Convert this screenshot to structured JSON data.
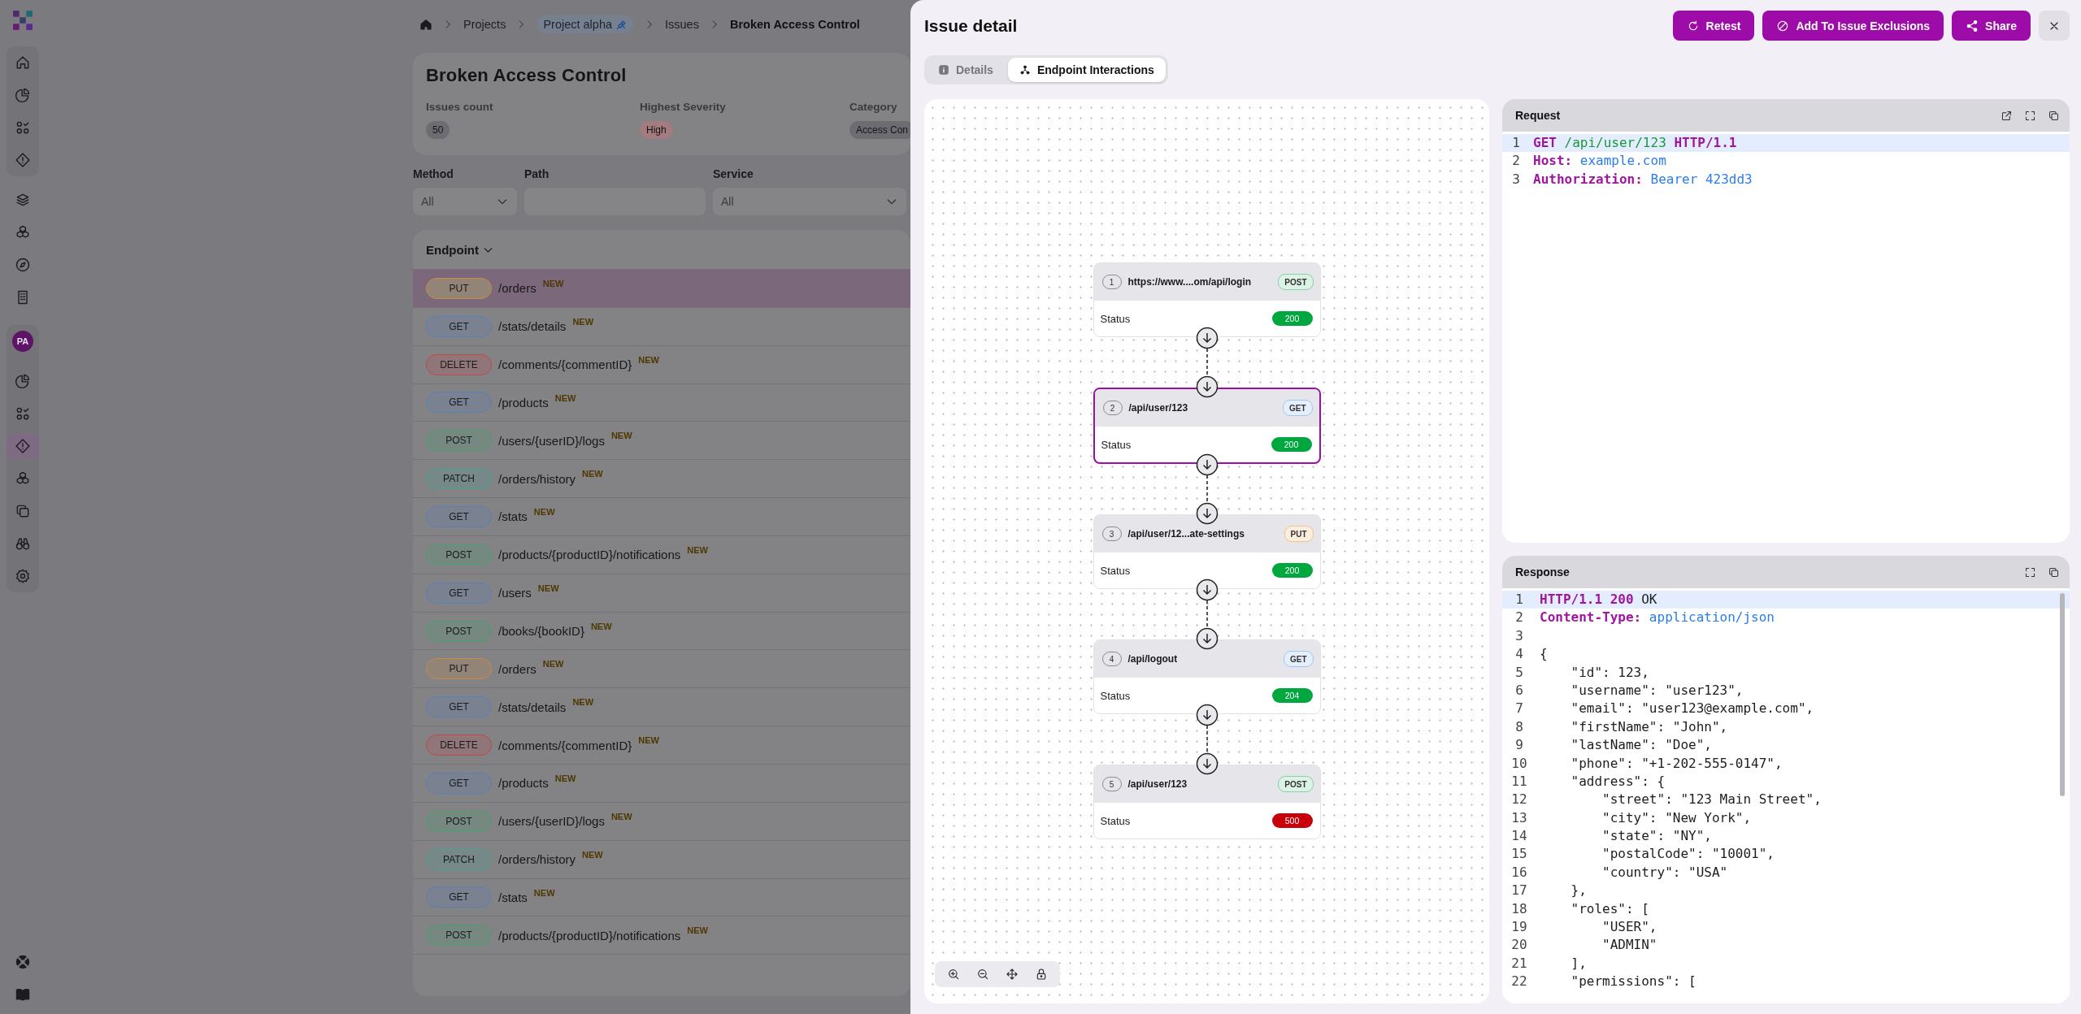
{
  "sidebar": {
    "top_items": [
      {
        "selected": false
      },
      {
        "selected": false
      },
      {
        "selected": false
      },
      {
        "selected": false
      }
    ],
    "nav_items": [
      {
        "selected": false
      },
      {
        "selected": false
      },
      {
        "selected": false
      },
      {
        "selected": false
      }
    ],
    "project": {
      "avatar": "PA",
      "items": [
        {
          "selected": false
        },
        {
          "selected": false
        },
        {
          "selected": true
        },
        {
          "selected": false
        },
        {
          "selected": false
        },
        {
          "selected": false
        },
        {
          "selected": false
        }
      ]
    },
    "bottom_items": [
      {
        "selected": false
      },
      {
        "selected": false
      }
    ]
  },
  "breadcrumb": [
    {
      "label": "Projects",
      "kind": "link"
    },
    {
      "label": "Project alpha",
      "kind": "project"
    },
    {
      "label": "Issues",
      "kind": "link"
    },
    {
      "label": "Broken Access Control",
      "kind": "current"
    }
  ],
  "summary": {
    "title": "Broken Access Control",
    "fields": [
      {
        "label": "Issues count",
        "value": "50",
        "color": "#6c6c72"
      },
      {
        "label": "Highest Severity",
        "value": "High",
        "color": "#a27c7e"
      },
      {
        "label": "Category",
        "value": "Access Con",
        "color": "#6c6c72"
      }
    ]
  },
  "filters": [
    {
      "label": "Method",
      "value": "All",
      "kind": "select"
    },
    {
      "label": "Path",
      "kind": "text"
    },
    {
      "label": "Service",
      "value": "All",
      "kind": "select"
    }
  ],
  "table": {
    "columns": [
      "Endpoint"
    ],
    "rows": [
      {
        "method": "PUT",
        "color": "#c98a45",
        "path": "/orders",
        "badge": "NEW",
        "selected": true
      },
      {
        "method": "GET",
        "color": "#5a80b8",
        "path": "/stats/details",
        "badge": "NEW",
        "selected": false
      },
      {
        "method": "DELETE",
        "color": "#c04848",
        "path": "/comments/{commentID}",
        "badge": "NEW",
        "selected": false
      },
      {
        "method": "GET",
        "color": "#5a80b8",
        "path": "/products",
        "badge": "NEW",
        "selected": false
      },
      {
        "method": "POST",
        "color": "#48a070",
        "path": "/users/{userID}/logs",
        "badge": "NEW",
        "selected": false
      },
      {
        "method": "PATCH",
        "color": "#48a090",
        "path": "/orders/history",
        "badge": "NEW",
        "selected": false
      },
      {
        "method": "GET",
        "color": "#5a80b8",
        "path": "/stats",
        "badge": "NEW",
        "selected": false
      },
      {
        "method": "POST",
        "color": "#48a070",
        "path": "/products/{productID}/notifications",
        "badge": "NEW",
        "selected": false
      },
      {
        "method": "GET",
        "color": "#5a80b8",
        "path": "/users",
        "badge": "NEW",
        "selected": false
      },
      {
        "method": "POST",
        "color": "#48a070",
        "path": "/books/{bookID}",
        "badge": "NEW",
        "selected": false
      },
      {
        "method": "PUT",
        "color": "#c98a45",
        "path": "/orders",
        "badge": "NEW",
        "selected": false
      },
      {
        "method": "GET",
        "color": "#5a80b8",
        "path": "/stats/details",
        "badge": "NEW",
        "selected": false
      },
      {
        "method": "DELETE",
        "color": "#c04848",
        "path": "/comments/{commentID}",
        "badge": "NEW",
        "selected": false
      },
      {
        "method": "GET",
        "color": "#5a80b8",
        "path": "/products",
        "badge": "NEW",
        "selected": false
      },
      {
        "method": "POST",
        "color": "#48a070",
        "path": "/users/{userID}/logs",
        "badge": "NEW",
        "selected": false
      },
      {
        "method": "PATCH",
        "color": "#48a090",
        "path": "/orders/history",
        "badge": "NEW",
        "selected": false
      },
      {
        "method": "GET",
        "color": "#5a80b8",
        "path": "/stats",
        "badge": "NEW",
        "selected": false
      },
      {
        "method": "POST",
        "color": "#48a070",
        "path": "/products/{productID}/notifications",
        "badge": "NEW",
        "selected": false
      }
    ]
  },
  "issue_detail": {
    "title": "Issue detail",
    "actions": [
      {
        "label": "Retest",
        "kind": "retest"
      },
      {
        "label": "Add To Issue Exclusions",
        "kind": "exclude"
      },
      {
        "label": "Share",
        "kind": "share"
      }
    ],
    "tabs": [
      {
        "label": "Details",
        "kind": "info",
        "selected": false
      },
      {
        "label": "Endpoint Interactions",
        "kind": "flow",
        "selected": true
      }
    ],
    "flow": {
      "nodes": [
        {
          "number": "1",
          "url": "https://www....om/api/login",
          "method": {
            "label": "POST",
            "color": "#86d1a5"
          },
          "status_label": "Status",
          "status": {
            "label": "200",
            "color": "#00a63e"
          },
          "selected": false
        },
        {
          "number": "2",
          "url": "/api/user/123",
          "method": {
            "label": "GET",
            "color": "#9fc6f2"
          },
          "status_label": "Status",
          "status": {
            "label": "200",
            "color": "#00a63e"
          },
          "selected": true
        },
        {
          "number": "3",
          "url": "/api/user/12...ate-settings",
          "method": {
            "label": "PUT",
            "color": "#f2c28c"
          },
          "status_label": "Status",
          "status": {
            "label": "200",
            "color": "#00a63e"
          },
          "selected": false
        },
        {
          "number": "4",
          "url": "/api/logout",
          "method": {
            "label": "GET",
            "color": "#9fc6f2"
          },
          "status_label": "Status",
          "status": {
            "label": "204",
            "color": "#00a63e"
          },
          "selected": false
        },
        {
          "number": "5",
          "url": "/api/user/123",
          "method": {
            "label": "POST",
            "color": "#86d1a5"
          },
          "status_label": "Status",
          "status": {
            "label": "500",
            "color": "#c8000a"
          },
          "selected": false
        }
      ]
    },
    "request": {
      "title": "Request",
      "lines": [
        {
          "number": "1",
          "highlighted": true,
          "tokens": [
            {
              "kind": "keyword",
              "text": "GET"
            },
            {
              "kind": "path",
              "text": " /api/user/123 "
            },
            {
              "kind": "keyword",
              "text": "HTTP/1.1"
            }
          ]
        },
        {
          "number": "2",
          "highlighted": false,
          "tokens": [
            {
              "kind": "keyword",
              "text": "Host:"
            },
            {
              "kind": "value",
              "text": " example.com"
            }
          ]
        },
        {
          "number": "3",
          "highlighted": false,
          "tokens": [
            {
              "kind": "keyword",
              "text": "Authorization:"
            },
            {
              "kind": "value",
              "text": " Bearer 423dd3"
            }
          ]
        }
      ]
    },
    "response": {
      "title": "Response",
      "lines": [
        {
          "number": "1",
          "highlighted": true,
          "tokens": [
            {
              "kind": "keyword",
              "text": "HTTP/1.1 200"
            },
            {
              "kind": "plain",
              "text": " OK"
            }
          ]
        },
        {
          "number": "2",
          "highlighted": false,
          "tokens": [
            {
              "kind": "keyword",
              "text": "Content-Type:"
            },
            {
              "kind": "value",
              "text": " application/json"
            }
          ]
        },
        {
          "number": "3",
          "highlighted": false
        },
        {
          "number": "4",
          "highlighted": false,
          "tokens": [
            {
              "kind": "plain",
              "text": "{"
            }
          ]
        },
        {
          "number": "5",
          "highlighted": false,
          "tokens": [
            {
              "kind": "plain",
              "text": "    \"id\": 123,"
            }
          ]
        },
        {
          "number": "6",
          "highlighted": false,
          "tokens": [
            {
              "kind": "plain",
              "text": "    \"username\": \"user123\","
            }
          ]
        },
        {
          "number": "7",
          "highlighted": false,
          "tokens": [
            {
              "kind": "plain",
              "text": "    \"email\": \"user123@example.com\","
            }
          ]
        },
        {
          "number": "8",
          "highlighted": false,
          "tokens": [
            {
              "kind": "plain",
              "text": "    \"firstName\": \"John\","
            }
          ]
        },
        {
          "number": "9",
          "highlighted": false,
          "tokens": [
            {
              "kind": "plain",
              "text": "    \"lastName\": \"Doe\","
            }
          ]
        },
        {
          "number": "10",
          "highlighted": false,
          "tokens": [
            {
              "kind": "plain",
              "text": "    \"phone\": \"+1-202-555-0147\","
            }
          ]
        },
        {
          "number": "11",
          "highlighted": false,
          "tokens": [
            {
              "kind": "plain",
              "text": "    \"address\": {"
            }
          ]
        },
        {
          "number": "12",
          "highlighted": false,
          "tokens": [
            {
              "kind": "plain",
              "text": "        \"street\": \"123 Main Street\","
            }
          ]
        },
        {
          "number": "13",
          "highlighted": false,
          "tokens": [
            {
              "kind": "plain",
              "text": "        \"city\": \"New York\","
            }
          ]
        },
        {
          "number": "14",
          "highlighted": false,
          "tokens": [
            {
              "kind": "plain",
              "text": "        \"state\": \"NY\","
            }
          ]
        },
        {
          "number": "15",
          "highlighted": false,
          "tokens": [
            {
              "kind": "plain",
              "text": "        \"postalCode\": \"10001\","
            }
          ]
        },
        {
          "number": "16",
          "highlighted": false,
          "tokens": [
            {
              "kind": "plain",
              "text": "        \"country\": \"USA\""
            }
          ]
        },
        {
          "number": "17",
          "highlighted": false,
          "tokens": [
            {
              "kind": "plain",
              "text": "    },"
            }
          ]
        },
        {
          "number": "18",
          "highlighted": false,
          "tokens": [
            {
              "kind": "plain",
              "text": "    \"roles\": ["
            }
          ]
        },
        {
          "number": "19",
          "highlighted": false,
          "tokens": [
            {
              "kind": "plain",
              "text": "        \"USER\","
            }
          ]
        },
        {
          "number": "20",
          "highlighted": false,
          "tokens": [
            {
              "kind": "plain",
              "text": "        \"ADMIN\""
            }
          ]
        },
        {
          "number": "21",
          "highlighted": false,
          "tokens": [
            {
              "kind": "plain",
              "text": "    ],"
            }
          ]
        },
        {
          "number": "22",
          "highlighted": false,
          "tokens": [
            {
              "kind": "plain",
              "text": "    \"permissions\": ["
            }
          ]
        }
      ]
    }
  }
}
